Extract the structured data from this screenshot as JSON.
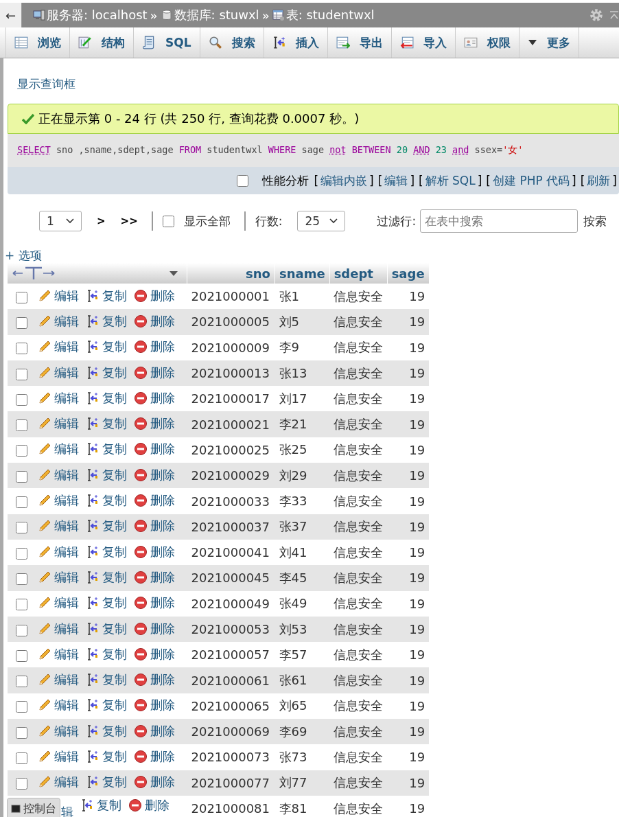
{
  "topbar": {
    "back": "←",
    "crumbs": [
      {
        "label": "服务器: localhost"
      },
      {
        "label": "数据库: stuwxl"
      },
      {
        "label": "表: studentwxl"
      }
    ],
    "separator": "»"
  },
  "tabs": [
    {
      "label": "浏览"
    },
    {
      "label": "结构"
    },
    {
      "label": "SQL"
    },
    {
      "label": "搜索"
    },
    {
      "label": "插入"
    },
    {
      "label": "导出"
    },
    {
      "label": "导入"
    },
    {
      "label": "权限"
    },
    {
      "label": "更多"
    }
  ],
  "query_box_link": "显示查询框",
  "success_message": "正在显示第 0 - 24 行 (共 250 行, 查询花费 0.0007 秒。)",
  "sql": [
    {
      "kind": "keyword_link",
      "text": "SELECT"
    },
    {
      "kind": "plain",
      "text": " sno ,sname,sdept,sage "
    },
    {
      "kind": "keyword",
      "text": "FROM"
    },
    {
      "kind": "plain",
      "text": " studentwxl "
    },
    {
      "kind": "keyword",
      "text": "WHERE"
    },
    {
      "kind": "plain",
      "text": " sage "
    },
    {
      "kind": "keyword_link",
      "text": "not"
    },
    {
      "kind": "keyword",
      "text": " BETWEEN "
    },
    {
      "kind": "number",
      "text": "20 "
    },
    {
      "kind": "keyword_link",
      "text": "AND"
    },
    {
      "kind": "number",
      "text": " 23 "
    },
    {
      "kind": "keyword_link",
      "text": "and"
    },
    {
      "kind": "plain",
      "text": " ssex="
    },
    {
      "kind": "string",
      "text": "'女'"
    }
  ],
  "profiling": {
    "label": "性能分析",
    "checked": false,
    "links": [
      {
        "open": "[",
        "label": "编辑内嵌",
        "close": "]"
      },
      {
        "open": "[",
        "label": "编辑",
        "close": "]"
      },
      {
        "open": "[",
        "label": "解析 SQL",
        "close": "]"
      },
      {
        "open": "[",
        "label": "创建 PHP 代码",
        "close": "]"
      },
      {
        "open": "[",
        "label": "刷新",
        "close": "]"
      }
    ]
  },
  "nav": {
    "page": "1",
    "next": ">",
    "last": ">>",
    "show_all": {
      "label": "显示全部",
      "checked": false
    },
    "rows_label": "行数:",
    "rows_value": "25",
    "filter_label": "过滤行:",
    "filter_placeholder": "在表中搜索",
    "cut_label": "按索"
  },
  "options_link": "+ 选项",
  "table": {
    "columns": [
      "sno",
      "sname",
      "sdept",
      "sage"
    ],
    "rows": [
      {
        "kind": "full",
        "checked": false,
        "actions": [
          "编辑",
          "复制",
          "删除"
        ],
        "cells": [
          "2021000001",
          "张1",
          "信息安全",
          "19"
        ]
      },
      {
        "kind": "full",
        "checked": false,
        "actions": [
          "编辑",
          "复制",
          "删除"
        ],
        "cells": [
          "2021000005",
          "刘5",
          "信息安全",
          "19"
        ]
      },
      {
        "kind": "full",
        "checked": false,
        "actions": [
          "编辑",
          "复制",
          "删除"
        ],
        "cells": [
          "2021000009",
          "李9",
          "信息安全",
          "19"
        ]
      },
      {
        "kind": "full",
        "checked": false,
        "actions": [
          "编辑",
          "复制",
          "删除"
        ],
        "cells": [
          "2021000013",
          "张13",
          "信息安全",
          "19"
        ]
      },
      {
        "kind": "full",
        "checked": false,
        "actions": [
          "编辑",
          "复制",
          "删除"
        ],
        "cells": [
          "2021000017",
          "刘17",
          "信息安全",
          "19"
        ]
      },
      {
        "kind": "full",
        "checked": false,
        "actions": [
          "编辑",
          "复制",
          "删除"
        ],
        "cells": [
          "2021000021",
          "李21",
          "信息安全",
          "19"
        ]
      },
      {
        "kind": "full",
        "checked": false,
        "actions": [
          "编辑",
          "复制",
          "删除"
        ],
        "cells": [
          "2021000025",
          "张25",
          "信息安全",
          "19"
        ]
      },
      {
        "kind": "full",
        "checked": false,
        "actions": [
          "编辑",
          "复制",
          "删除"
        ],
        "cells": [
          "2021000029",
          "刘29",
          "信息安全",
          "19"
        ]
      },
      {
        "kind": "full",
        "checked": false,
        "actions": [
          "编辑",
          "复制",
          "删除"
        ],
        "cells": [
          "2021000033",
          "李33",
          "信息安全",
          "19"
        ]
      },
      {
        "kind": "full",
        "checked": false,
        "actions": [
          "编辑",
          "复制",
          "删除"
        ],
        "cells": [
          "2021000037",
          "张37",
          "信息安全",
          "19"
        ]
      },
      {
        "kind": "full",
        "checked": false,
        "actions": [
          "编辑",
          "复制",
          "删除"
        ],
        "cells": [
          "2021000041",
          "刘41",
          "信息安全",
          "19"
        ]
      },
      {
        "kind": "full",
        "checked": false,
        "actions": [
          "编辑",
          "复制",
          "删除"
        ],
        "cells": [
          "2021000045",
          "李45",
          "信息安全",
          "19"
        ]
      },
      {
        "kind": "full",
        "checked": false,
        "actions": [
          "编辑",
          "复制",
          "删除"
        ],
        "cells": [
          "2021000049",
          "张49",
          "信息安全",
          "19"
        ]
      },
      {
        "kind": "full",
        "checked": false,
        "actions": [
          "编辑",
          "复制",
          "删除"
        ],
        "cells": [
          "2021000053",
          "刘53",
          "信息安全",
          "19"
        ]
      },
      {
        "kind": "full",
        "checked": false,
        "actions": [
          "编辑",
          "复制",
          "删除"
        ],
        "cells": [
          "2021000057",
          "李57",
          "信息安全",
          "19"
        ]
      },
      {
        "kind": "full",
        "checked": false,
        "actions": [
          "编辑",
          "复制",
          "删除"
        ],
        "cells": [
          "2021000061",
          "张61",
          "信息安全",
          "19"
        ]
      },
      {
        "kind": "full",
        "checked": false,
        "actions": [
          "编辑",
          "复制",
          "删除"
        ],
        "cells": [
          "2021000065",
          "刘65",
          "信息安全",
          "19"
        ]
      },
      {
        "kind": "full",
        "checked": false,
        "actions": [
          "编辑",
          "复制",
          "删除"
        ],
        "cells": [
          "2021000069",
          "李69",
          "信息安全",
          "19"
        ]
      },
      {
        "kind": "full",
        "checked": false,
        "actions": [
          "编辑",
          "复制",
          "删除"
        ],
        "cells": [
          "2021000073",
          "张73",
          "信息安全",
          "19"
        ]
      },
      {
        "kind": "full",
        "checked": false,
        "actions": [
          "编辑",
          "复制",
          "删除"
        ],
        "cells": [
          "2021000077",
          "刘77",
          "信息安全",
          "19"
        ]
      },
      {
        "kind": "partial",
        "actions": [
          "辑",
          "复制",
          "删除"
        ],
        "cells": [
          "2021000081",
          "李81",
          "信息安全",
          "19"
        ]
      }
    ]
  },
  "console_tab": "控制台"
}
